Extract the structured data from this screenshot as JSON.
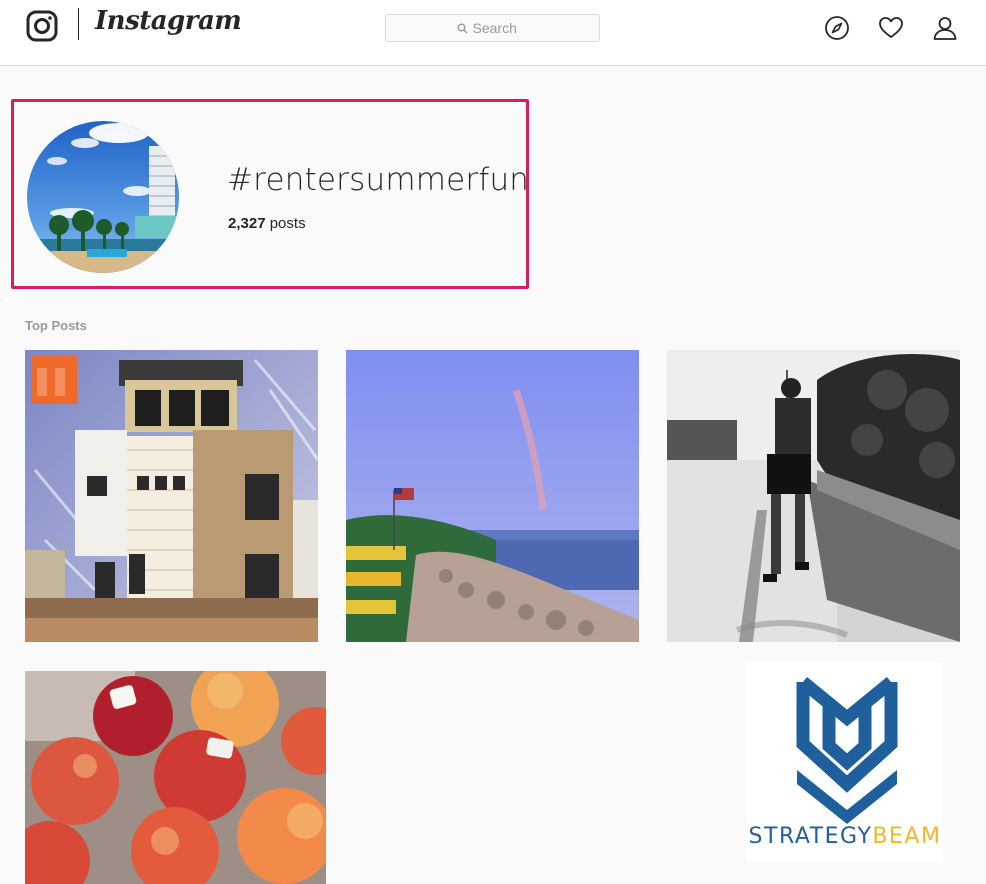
{
  "app": {
    "wordmark": "Instagram"
  },
  "search": {
    "placeholder": "Search"
  },
  "icons": {
    "logo": "instagram-glyph-icon",
    "explore": "compass-icon",
    "activity": "heart-icon",
    "profile": "person-icon",
    "search": "search-icon"
  },
  "profile": {
    "hashtag": "#rentersummerfun",
    "post_count": "2,327",
    "post_suffix": " posts"
  },
  "sections": {
    "top_posts": "Top Posts"
  },
  "posts": [
    {
      "subject": "modern townhouse"
    },
    {
      "subject": "rainbow over rocky shore with flag"
    },
    {
      "subject": "man walking on sidewalk black and white"
    },
    {
      "subject": "peaches"
    },
    {
      "subject": "strategybeam logo"
    }
  ],
  "logo_tile": {
    "brand_a": "STRATEGY",
    "brand_b": "BEAM"
  },
  "colors": {
    "highlight_border": "#d61e63",
    "brand_blue": "#1f5f9c",
    "brand_yellow": "#f2b823"
  }
}
